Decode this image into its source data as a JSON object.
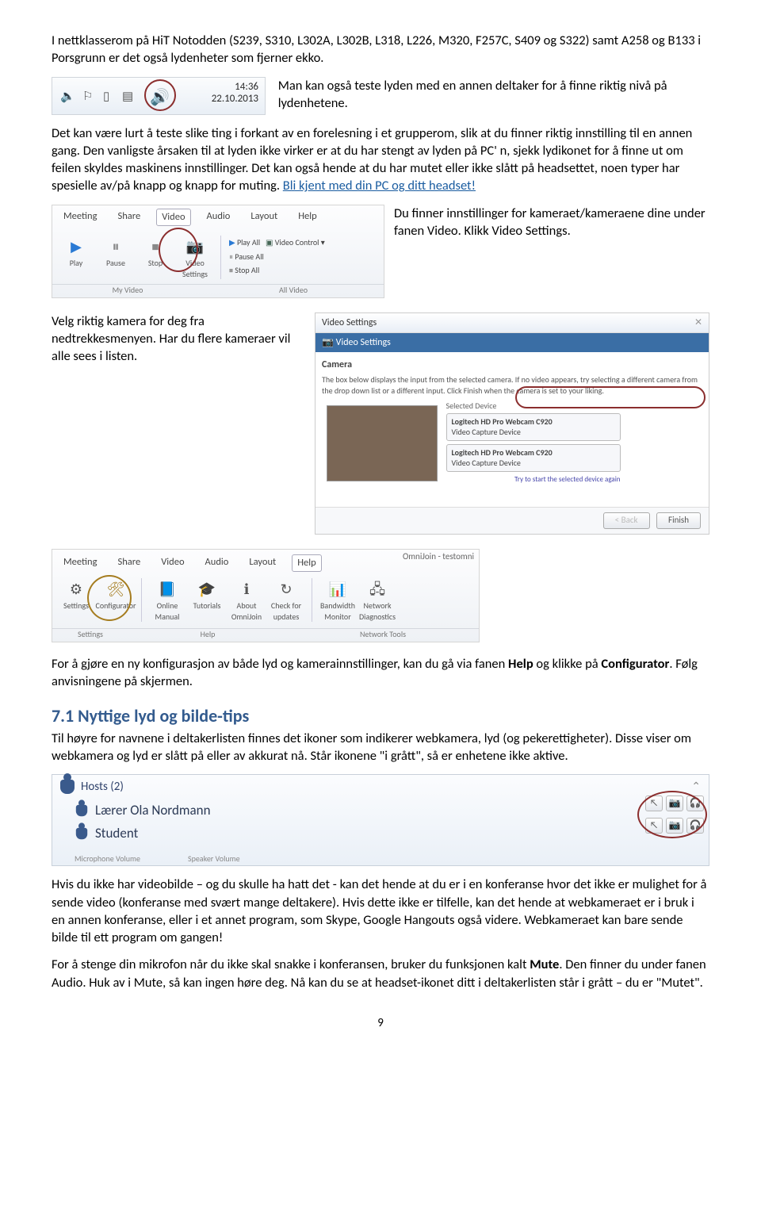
{
  "p1": "I nettklasserom på HiT Notodden (S239, S310, L302A, L302B, L318, L226, M320, F257C, S409 og S322) samt A258 og B133 i Porsgrunn er det også lydenheter som fjerner ekko.",
  "clock": {
    "time": "14:36",
    "date": "22.10.2013"
  },
  "p2a": "Man kan også teste lyden med en annen deltaker for å finne riktig nivå på lydenhetene.",
  "p2b": "Det kan være lurt å teste slike ting i forkant av en forelesning i et grupperom, slik at du finner riktig innstilling til en annen gang. Den vanligste årsaken til at lyden ikke virker er at du har stengt av lyden på PC' n, sjekk lydikonet for å finne ut om feilen skyldes maskinens innstillinger. Det kan også hende at du har mutet eller ikke slått på headsettet, noen typer har spesielle av/på knapp og knapp for muting. ",
  "p2c": "Bli kjent med din PC og ditt headset!",
  "toolbar": {
    "tabs": [
      "Meeting",
      "Share",
      "Video",
      "Audio",
      "Layout",
      "Help"
    ],
    "items": {
      "play": "Play",
      "pause": "Pause",
      "stop": "Stop",
      "video_settings_a": "Video",
      "video_settings_b": "Settings",
      "play_all": "Play All",
      "pause_all": "Pause All",
      "stop_all": "Stop All",
      "video_control": "Video Control"
    },
    "group_left": "My Video",
    "group_right": "All Video"
  },
  "p_right_top": "Du finner innstillinger for kameraet/kameraene dine under fanen Video. Klikk Video Settings.",
  "vs": {
    "title": "Video Settings",
    "band": "Video Settings",
    "sec": "Camera",
    "desc": "The box below displays the input from the selected camera. If no video appears, try selecting a different camera from the drop down list or a different input. Click Finish when the camera is set to your liking.",
    "sel": "Selected Device",
    "dev1_name": "Logitech HD Pro Webcam C920",
    "dev1_sub": "Video Capture Device",
    "dev2_name": "Logitech HD Pro Webcam C920",
    "dev2_sub": "Video Capture Device",
    "try": "Try to start the selected device again",
    "back": "< Back",
    "finish": "Finish"
  },
  "p_left_bottom": "Velg riktig kamera for deg fra nedtrekkesmenyen. Har du flere kameraer vil alle sees i listen.",
  "help_panel": {
    "title": "OmniJoin - testomni",
    "tabs": [
      "Meeting",
      "Share",
      "Video",
      "Audio",
      "Layout",
      "Help"
    ],
    "items": {
      "settings": "Settings",
      "configurator": "Configurator",
      "online_manual_a": "Online",
      "online_manual_b": "Manual",
      "tutorials": "Tutorials",
      "about_a": "About",
      "about_b": "OmniJoin",
      "check_a": "Check for",
      "check_b": "updates",
      "bw_a": "Bandwidth",
      "bw_b": "Monitor",
      "net_a": "Network",
      "net_b": "Diagnostics"
    },
    "group_a": "Settings",
    "group_b": "Help",
    "group_c": "Network Tools"
  },
  "p_help": "For å gjøre en ny konfigurasjon av både lyd og kamerainnstillinger, kan du gå via fanen ",
  "p_help_b1": "Help",
  "p_help_mid": " og klikke på ",
  "p_help_b2": "Configurator",
  "p_help_end": ". Følg anvisningene på skjermen.",
  "section_h": "7.1 Nyttige lyd og bilde-tips",
  "p_tips_1": "Til høyre for navnene i deltakerlisten finnes det ikoner som indikerer webkamera, lyd (og pekerettigheter). Disse viser om webkamera og lyd er slått på eller av akkurat nå. Står ikonene \"i grått\", så er enhetene ikke aktive.",
  "hosts": {
    "header": "Hosts (2)",
    "row1": "Lærer Ola Nordmann",
    "row2": "Student",
    "mic": "Microphone Volume",
    "spk": "Speaker Volume"
  },
  "p_tips_2": "Hvis du ikke har videobilde – og du skulle ha hatt det - kan det hende at du er i en konferanse hvor det ikke er mulighet for å sende video (konferanse med svært mange deltakere). Hvis dette ikke er tilfelle, kan det hende at webkameraet er i bruk i en annen konferanse, eller i et annet program, som Skype, Google Hangouts også videre. Webkameraet kan bare sende bilde til ett program om gangen!",
  "p_tips_3a": "For å stenge din mikrofon når du ikke skal snakke i konferansen, bruker du funksjonen kalt ",
  "p_tips_3b": "Mute",
  "p_tips_3c": ". Den finner du under fanen Audio. Huk av i Mute, så kan ingen høre deg. Nå kan du se at headset-ikonet ditt i deltakerlisten står i grått – du er \"Mutet\".",
  "page": "9"
}
